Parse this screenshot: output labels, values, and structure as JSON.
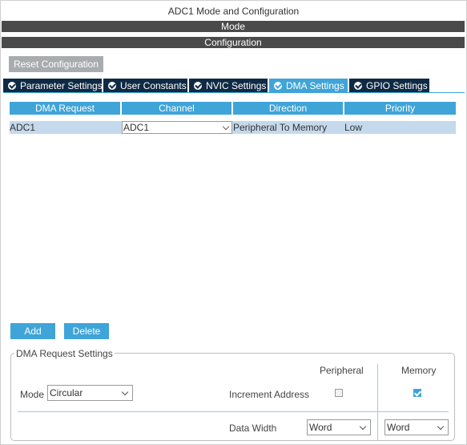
{
  "window": {
    "title": "ADC1 Mode and Configuration"
  },
  "sections": {
    "mode": "Mode",
    "configuration": "Configuration"
  },
  "toolbar": {
    "reset_label": "Reset Configuration"
  },
  "tabs": [
    {
      "label": "Parameter Settings",
      "active": false
    },
    {
      "label": "User Constants",
      "active": false
    },
    {
      "label": "NVIC Settings",
      "active": false
    },
    {
      "label": "DMA Settings",
      "active": true
    },
    {
      "label": "GPIO Settings",
      "active": false
    }
  ],
  "table": {
    "headers": [
      "DMA Request",
      "Channel",
      "Direction",
      "Priority"
    ],
    "rows": [
      {
        "request": "ADC1",
        "channel": "ADC1",
        "direction": "Peripheral To Memory",
        "priority": "Low"
      }
    ]
  },
  "actions": {
    "add_label": "Add",
    "delete_label": "Delete"
  },
  "request_settings": {
    "legend": "DMA Request Settings",
    "peripheral_header": "Peripheral",
    "memory_header": "Memory",
    "mode_label": "Mode",
    "mode_value": "Circular",
    "increment_label": "Increment Address",
    "peripheral_increment": false,
    "memory_increment": true,
    "data_width_label": "Data Width",
    "peripheral_width": "Word",
    "memory_width": "Word"
  },
  "colors": {
    "accent": "#3fa4d8",
    "tab_dark": "#0f2a44",
    "header_bar": "#4a4a4a",
    "selected_row": "#c5d9ec",
    "reset_button": "#a8acae"
  }
}
